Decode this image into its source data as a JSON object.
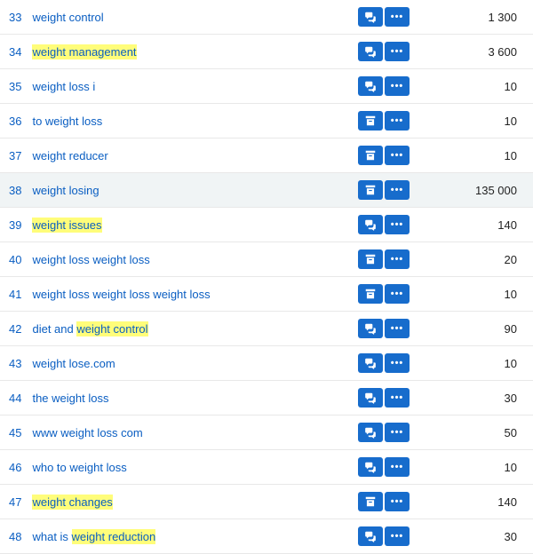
{
  "rows": [
    {
      "n": "33",
      "kw": "weight control",
      "hl": null,
      "icon": "chat",
      "vol": "1 300"
    },
    {
      "n": "34",
      "kw": "weight management",
      "hl": "weight management",
      "icon": "chat",
      "vol": "3 600"
    },
    {
      "n": "35",
      "kw": "weight loss i",
      "hl": null,
      "icon": "chat",
      "vol": "10"
    },
    {
      "n": "36",
      "kw": "to weight loss",
      "hl": null,
      "icon": "cart",
      "vol": "10"
    },
    {
      "n": "37",
      "kw": "weight reducer",
      "hl": null,
      "icon": "cart",
      "vol": "10"
    },
    {
      "n": "38",
      "kw": "weight losing",
      "hl": null,
      "icon": "cart",
      "vol": "135 000",
      "hover": true
    },
    {
      "n": "39",
      "kw": "weight issues",
      "hl": "weight issues",
      "icon": "chat",
      "vol": "140"
    },
    {
      "n": "40",
      "kw": "weight loss weight loss",
      "hl": null,
      "icon": "cart",
      "vol": "20"
    },
    {
      "n": "41",
      "kw": "weight loss weight loss weight loss",
      "hl": null,
      "icon": "cart",
      "vol": "10"
    },
    {
      "n": "42",
      "kw": "diet and weight control",
      "hl": "weight control",
      "icon": "chat",
      "vol": "90"
    },
    {
      "n": "43",
      "kw": "weight lose.com",
      "hl": null,
      "icon": "chat",
      "vol": "10"
    },
    {
      "n": "44",
      "kw": "the weight loss",
      "hl": null,
      "icon": "chat",
      "vol": "30"
    },
    {
      "n": "45",
      "kw": "www weight loss com",
      "hl": null,
      "icon": "chat",
      "vol": "50"
    },
    {
      "n": "46",
      "kw": "who to weight loss",
      "hl": null,
      "icon": "chat",
      "vol": "10"
    },
    {
      "n": "47",
      "kw": "weight changes",
      "hl": "weight changes",
      "icon": "cart",
      "vol": "140"
    },
    {
      "n": "48",
      "kw": "what is weight reduction",
      "hl": "weight reduction",
      "icon": "chat",
      "vol": "30"
    }
  ]
}
